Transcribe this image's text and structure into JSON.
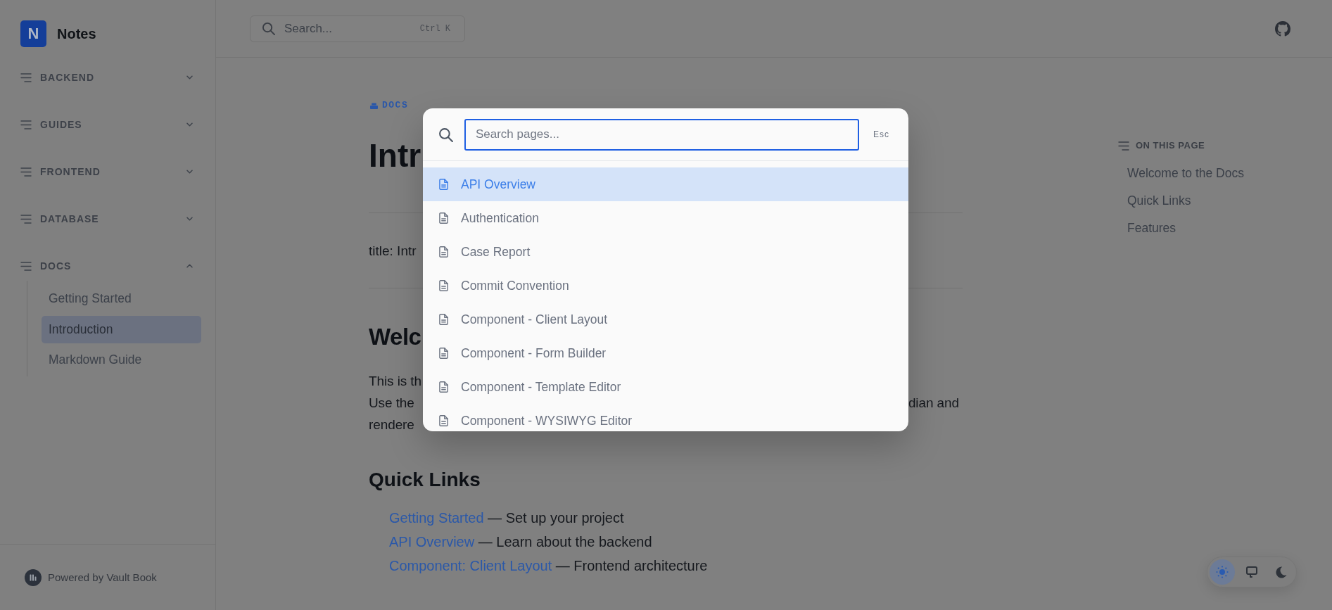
{
  "sidebar": {
    "logo": {
      "letter": "N",
      "title": "Notes"
    },
    "sections": [
      {
        "label": "BACKEND",
        "expanded": false
      },
      {
        "label": "GUIDES",
        "expanded": false
      },
      {
        "label": "FRONTEND",
        "expanded": false
      },
      {
        "label": "DATABASE",
        "expanded": false
      },
      {
        "label": "DOCS",
        "expanded": true,
        "children": [
          {
            "label": "Getting Started",
            "selected": false
          },
          {
            "label": "Introduction",
            "selected": true
          },
          {
            "label": "Markdown Guide",
            "selected": false
          }
        ]
      }
    ],
    "footer": "Powered by Vault Book"
  },
  "topbar": {
    "search": {
      "placeholder": "Search...",
      "shortcut": "Ctrl K"
    }
  },
  "content": {
    "breadcrumb": "DOCS",
    "title": "Intr",
    "frontmatter": "title: Intr",
    "heading": "Welc",
    "paragraph_lines": [
      {
        "left": "This is th"
      },
      {
        "left": "Use the",
        "right": "dian and"
      },
      {
        "left": "rendere"
      }
    ],
    "quick_links_heading": "Quick Links",
    "quick_links": [
      {
        "link": "Getting Started",
        "description": "— Set up your project"
      },
      {
        "link": "API Overview",
        "description": "— Learn about the backend"
      },
      {
        "link": "Component: Client Layout",
        "description": "— Frontend architecture"
      }
    ]
  },
  "toc": {
    "heading": "ON THIS PAGE",
    "items": [
      "Welcome to the Docs",
      "Quick Links",
      "Features"
    ]
  },
  "theme_toggle": [
    {
      "kind": "light",
      "selected": true
    },
    {
      "kind": "system",
      "selected": false
    },
    {
      "kind": "dark",
      "selected": false
    }
  ],
  "search_dialog": {
    "placeholder": "Search pages...",
    "dismiss_key": "Esc",
    "results": [
      {
        "title": "API Overview",
        "selected": true
      },
      {
        "title": "Authentication",
        "selected": false
      },
      {
        "title": "Case Report",
        "selected": false
      },
      {
        "title": "Commit Convention",
        "selected": false
      },
      {
        "title": "Component - Client Layout",
        "selected": false
      },
      {
        "title": "Component - Form Builder",
        "selected": false
      },
      {
        "title": "Component - Template Editor",
        "selected": false
      },
      {
        "title": "Component - WYSIWYG Editor",
        "selected": false
      }
    ]
  }
}
